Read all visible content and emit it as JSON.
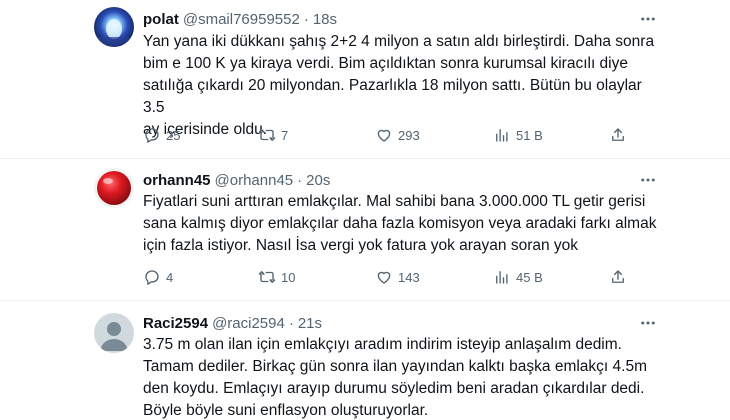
{
  "tweets": [
    {
      "name": "polat",
      "handle": "@smail76959552",
      "dot": "·",
      "time": "18s",
      "lines": [
        "Yan yana iki dükkanı şahış 2+2 4 milyon a satın aldı birleştirdi. Daha sonra",
        "bim e 100 K ya kiraya verdi. Bim açıldıktan sonra kurumsal kiracılı diye",
        "satılığa çıkardı 20 milyondan. Pazarlıkla 18 milyon sattı. Bütün bu olaylar 3.5",
        "ay içerisinde oldu."
      ],
      "replies": "25",
      "retweets": "7",
      "likes": "293",
      "views": "51 B",
      "avatar_color": "#1b2a6b"
    },
    {
      "name": "orhann45",
      "handle": "@orhann45",
      "dot": "·",
      "time": "20s",
      "lines": [
        "Fiyatlari suni arttıran emlakçılar. Mal sahibi bana 3.000.000 TL getir gerisi",
        "sana kalmış diyor emlakçılar daha fazla komisyon veya aradaki farkı almak",
        "için fazla istiyor. Nasıl İsa vergi yok fatura yok arayan soran yok"
      ],
      "replies": "4",
      "retweets": "10",
      "likes": "143",
      "views": "45 B",
      "avatar_color": "#d3131b"
    },
    {
      "name": "Raci2594",
      "handle": "@raci2594",
      "dot": "·",
      "time": "21s",
      "lines": [
        "3.75 m olan ilan için emlakçıyı aradım indirim isteyip anlaşalım dedim.",
        "Tamam dediler. Birkaç gün sonra ilan yayından kalktı başka emlakçı 4.5m",
        "den koydu. Emlaçıyı arayıp durumu söyledim beni aradan çıkardılar dedi.",
        "Böyle böyle suni enflasyon oluşturuyorlar."
      ],
      "avatar_color": "#cfd9de"
    }
  ],
  "colors": {
    "text": "#0f1419",
    "secondary": "#536471",
    "divider": "#eff3f4"
  }
}
